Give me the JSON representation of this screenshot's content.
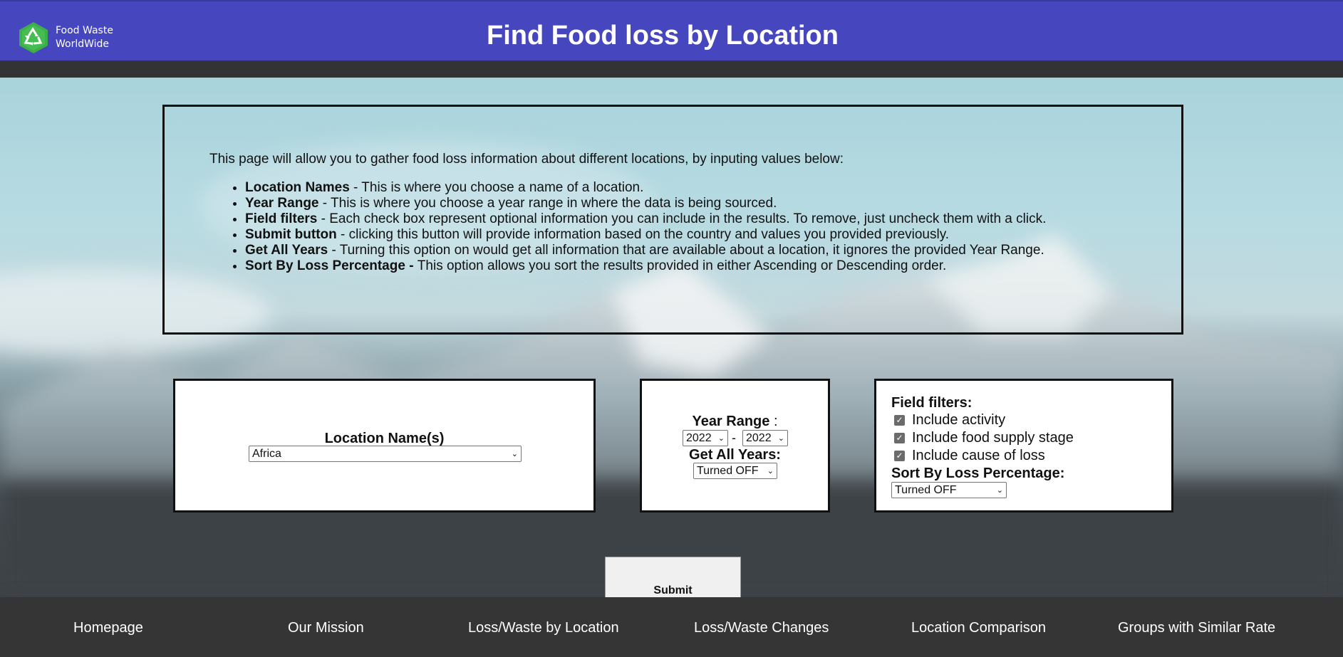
{
  "header": {
    "logo_line1": "Food Waste",
    "logo_line2": "WorldWide",
    "title": "Find Food loss by Location",
    "color": "#4646bf"
  },
  "info": {
    "intro": "This page will allow you to gather food loss information about different locations, by inputing values below:",
    "items": [
      {
        "term": "Location Names",
        "desc": " - This is where you choose a name of a location."
      },
      {
        "term": "Year Range",
        "desc": " - This is where you choose a year range in where the data is being sourced."
      },
      {
        "term": "Field filters",
        "desc": " - Each check box represent optional information you can include in the results. To remove, just uncheck them with a click."
      },
      {
        "term": "Submit button",
        "desc": " - clicking this button will provide information based on the country and values you provided previously."
      },
      {
        "term": "Get All Years",
        "desc": " - Turning this option on would get all information that are available about a location, it ignores the provided Year Range."
      },
      {
        "term": "Sort By Loss Percentage - ",
        "desc": "This option allows you sort the results provided in either Ascending or Descending order."
      }
    ]
  },
  "location": {
    "label": "Location Name(s)",
    "selected": "Africa"
  },
  "year_range": {
    "label": "Year Range",
    "colon": " :",
    "from": "2022",
    "dash": "-",
    "to": "2022",
    "get_all_label": "Get All Years:",
    "get_all_selected": "Turned OFF"
  },
  "filters": {
    "title": "Field filters:",
    "checkboxes": [
      {
        "label": "Include activity",
        "checked": true
      },
      {
        "label": "Include food supply stage",
        "checked": true
      },
      {
        "label": "Include cause of loss",
        "checked": true
      }
    ],
    "sort_label": "Sort By Loss Percentage:",
    "sort_selected": "Turned OFF"
  },
  "submit_label": "Submit",
  "footer_nav": [
    "Homepage",
    "Our Mission",
    "Loss/Waste by Location",
    "Loss/Waste Changes",
    "Location Comparison",
    "Groups with Similar Rate"
  ],
  "icons": {
    "logo": "recycle-icon",
    "dropdown": "chevron-down-icon",
    "checkbox": "check-icon"
  }
}
